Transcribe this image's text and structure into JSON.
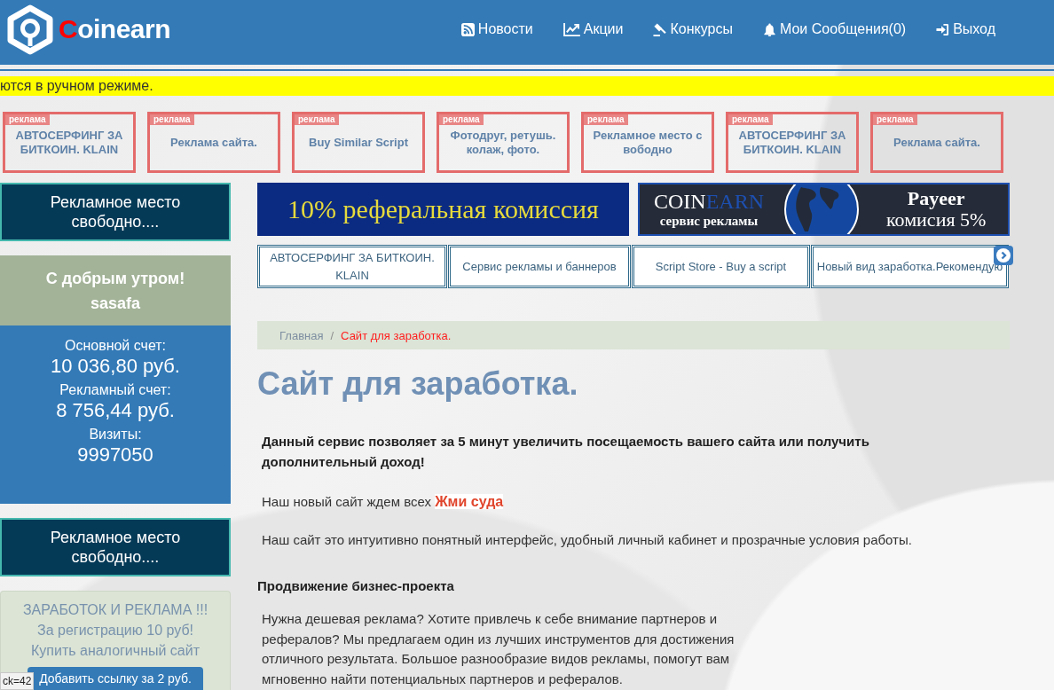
{
  "header": {
    "logo": "Coinearn",
    "nav": [
      {
        "kind": "news",
        "label": "Новости"
      },
      {
        "kind": "promotions",
        "label": "Акции"
      },
      {
        "kind": "contests",
        "label": "Конкурсы"
      },
      {
        "kind": "messages",
        "label": "Мои Сообщения(0)"
      },
      {
        "kind": "logout",
        "label": "Выход"
      }
    ]
  },
  "notice": "ются в ручном режиме.",
  "ad_boxes": [
    {
      "tag": "реклама",
      "text": "АВТОСЕРФИНГ ЗА БИТКОИН. KLAIN"
    },
    {
      "tag": "реклама",
      "text": "Реклама сайта."
    },
    {
      "tag": "реклама",
      "text": "Buy Similar Script"
    },
    {
      "tag": "реклама",
      "text": "Фотодруг, ретушь. колаж, фото."
    },
    {
      "tag": "реклама",
      "text": "Рекламное место с вободно"
    },
    {
      "tag": "реклама",
      "text": "АВТОСЕРФИНГ ЗА БИТКОИН. KLAIN"
    },
    {
      "tag": "реклама",
      "text": "Реклама сайта."
    }
  ],
  "sidebar": {
    "ad_top": "Рекламное место свободно....",
    "greeting": "С добрым утром!",
    "username": "sasafa",
    "balances": [
      {
        "label": "Основной счет:",
        "value": "10 036,80 руб."
      },
      {
        "label": "Рекламный счет:",
        "value": "8 756,44 руб."
      },
      {
        "label": "Визиты:",
        "value": "9997050"
      }
    ],
    "ad_bottom": "Рекламное место свободно....",
    "promo": {
      "lines": [
        "ЗАРАБОТОК И РЕКЛАМА !!!",
        "За регистрацию 10 руб!",
        "Купить аналогичный сайт"
      ],
      "button": "Добавить ссылку за 2 руб."
    },
    "status_tooltip": "ck=42"
  },
  "banners": [
    {
      "kind": "referral",
      "text": "10% реферальная комиссия"
    },
    {
      "kind": "payeer",
      "brand_parts": [
        {
          "text": "COIN",
          "color": "#ffffff"
        },
        {
          "text": "EARN",
          "color": "#1d4fb0"
        }
      ],
      "tagline": "сервис рекламы",
      "title": "Payeer",
      "subtitle": "комисия 5%"
    }
  ],
  "carousel_links": [
    "АВТОСЕРФИНГ ЗА БИТКОИН. KLAIN",
    "Сервис рекламы и баннеров",
    "Script Store - Buy a script",
    "Новый вид заработка.Рекомендую"
  ],
  "breadcrumb": {
    "separator": "/",
    "items": [
      {
        "label": "Главная",
        "current": false
      },
      {
        "label": "Сайт для заработка.",
        "current": true
      }
    ]
  },
  "content": {
    "title": "Сайт для заработка.",
    "blocks": [
      {
        "kind": "lead",
        "text": "Данный сервис позволяет за 5 минут увеличить посещаемость вашего сайта или получить дополнительный доход!"
      },
      {
        "kind": "intro",
        "text": "Наш новый сайт ждем всех",
        "link": "Жми суда"
      },
      {
        "kind": "paragraph",
        "text": "Наш сайт это интуитивно понятный интерфейс, удобный личный кабинет и прозрачные условия работы."
      },
      {
        "kind": "heading",
        "text": "Продвижение бизнес-проекта"
      },
      {
        "kind": "paragraph",
        "text": "Нужна дешевая реклама? Хотите привлечь к себе внимание партнеров и рефералов? Мы предлагаем один из лучших инструментов для достижения отличного результата. Большое разнообразие видов рекламы, помогут вам мгновенно найти потенциальных партнеров и рефералов."
      }
    ]
  }
}
